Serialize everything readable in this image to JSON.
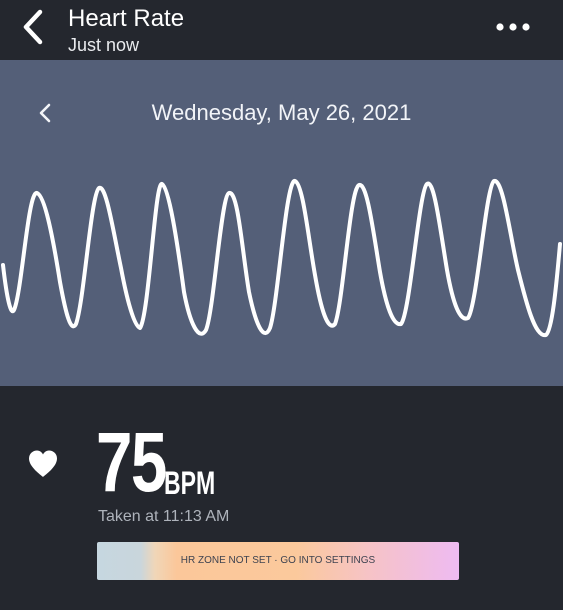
{
  "header": {
    "title": "Heart Rate",
    "subtitle": "Just now",
    "back_icon": "chevron-left-icon",
    "more_icon": "more-horizontal-icon"
  },
  "date_nav": {
    "label": "Wednesday, May 26, 2021",
    "prev_icon": "chevron-left-icon"
  },
  "reading": {
    "icon": "heart-icon",
    "value": "75",
    "unit": "BPM",
    "taken_at": "Taken at 11:13 AM"
  },
  "zone_bar": {
    "label": "HR ZONE NOT SET · GO INTO SETTINGS"
  },
  "colors": {
    "background": "#24272e",
    "panel": "#545f78",
    "waveform": "#ffffff",
    "text": "#ffffff",
    "muted_text": "#aeb3bb"
  }
}
